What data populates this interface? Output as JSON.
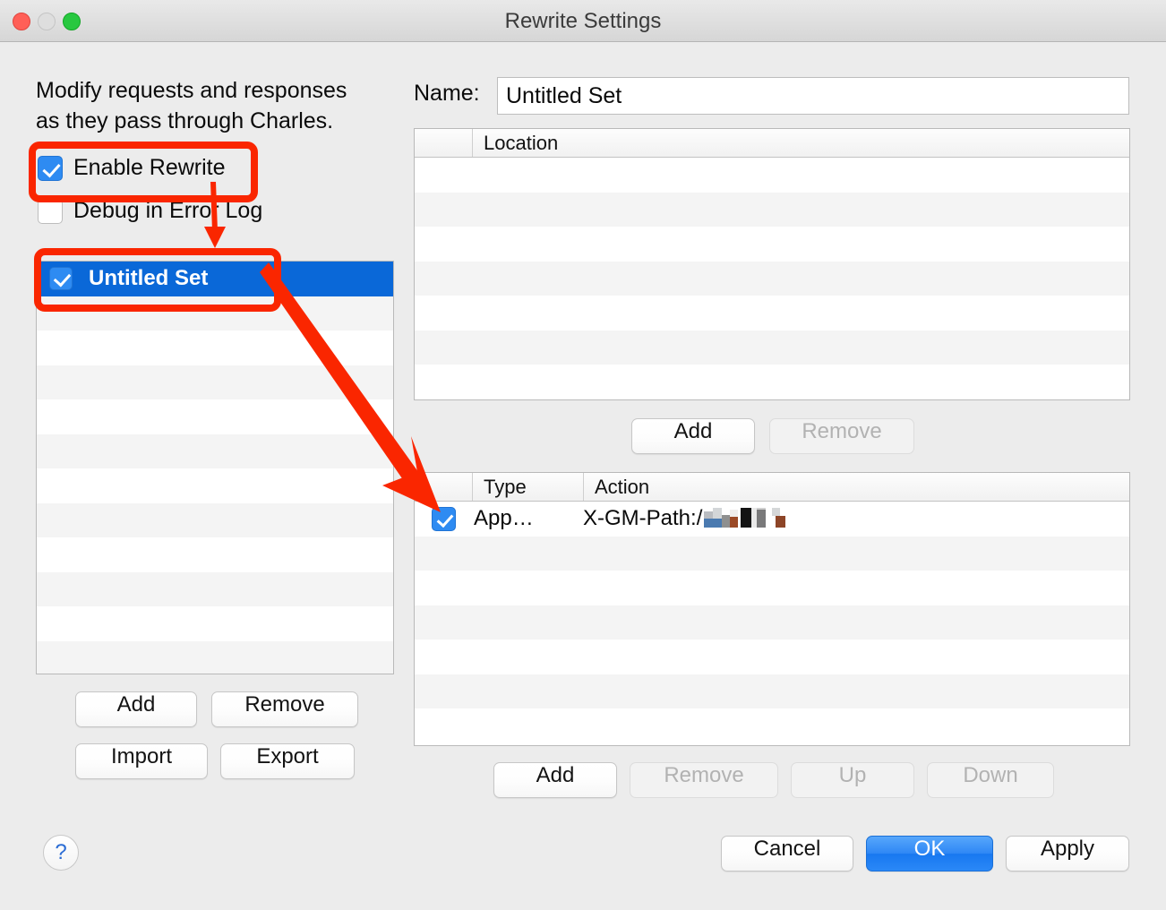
{
  "window": {
    "title": "Rewrite Settings",
    "traffic_lights": [
      "close",
      "minimize",
      "zoom"
    ]
  },
  "left": {
    "description": "Modify requests and responses\nas they pass through Charles.",
    "checkboxes": [
      {
        "label": "Enable Rewrite",
        "checked": true
      },
      {
        "label": "Debug in Error Log",
        "checked": false
      }
    ],
    "sets": [
      {
        "label": "Untitled Set",
        "checked": true,
        "selected": true
      }
    ],
    "buttons": {
      "add": "Add",
      "remove": "Remove",
      "import": "Import",
      "export": "Export"
    },
    "help": "?"
  },
  "right": {
    "name_label": "Name:",
    "name_value": "Untitled Set",
    "location_table": {
      "columns": [
        "Location"
      ],
      "rows": []
    },
    "location_buttons": {
      "add": {
        "label": "Add",
        "enabled": true
      },
      "remove": {
        "label": "Remove",
        "enabled": false
      }
    },
    "rules_table": {
      "columns": [
        "Type",
        "Action"
      ],
      "rows": [
        {
          "checked": true,
          "type": "App…",
          "action": "X-GM-Path:/",
          "action_redacted": true
        }
      ]
    },
    "rules_buttons": {
      "add": {
        "label": "Add",
        "enabled": true
      },
      "remove": {
        "label": "Remove",
        "enabled": false
      },
      "up": {
        "label": "Up",
        "enabled": false
      },
      "down": {
        "label": "Down",
        "enabled": false
      }
    }
  },
  "footer": {
    "cancel": "Cancel",
    "ok": "OK",
    "apply": "Apply"
  },
  "annotations": {
    "highlight_color": "#FA2600",
    "boxes": [
      {
        "name": "enable-rewrite-highlight"
      },
      {
        "name": "untitled-set-highlight"
      }
    ],
    "arrows": [
      {
        "name": "arrow-enable-to-set"
      },
      {
        "name": "arrow-set-to-rule"
      }
    ]
  }
}
